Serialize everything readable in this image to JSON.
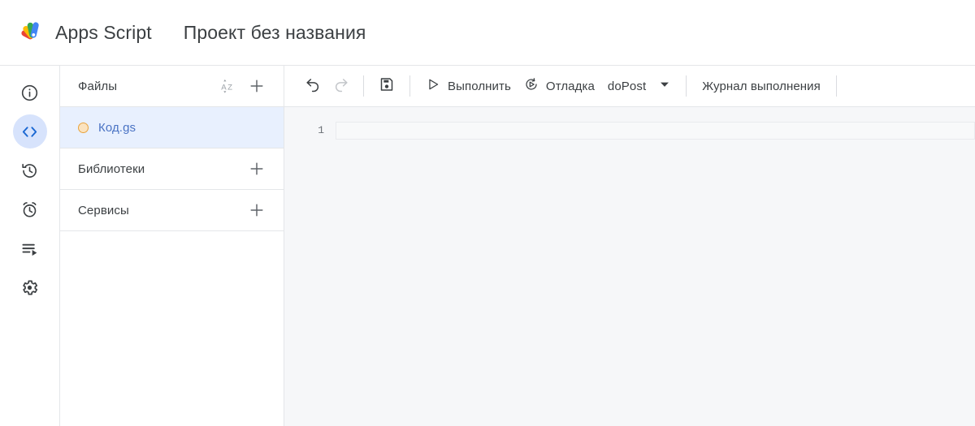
{
  "header": {
    "logo_icon": "apps-script-logo",
    "brand": "Apps Script",
    "project_title": "Проект без названия",
    "logo_colors": {
      "red": "#ea4335",
      "yellow": "#fbbc04",
      "green": "#34a853",
      "blue": "#4285f4"
    }
  },
  "rail": {
    "items": [
      {
        "icon": "info-icon",
        "name": "overview",
        "active": false
      },
      {
        "icon": "code-icon",
        "name": "editor",
        "active": true
      },
      {
        "icon": "history-icon",
        "name": "project-history",
        "active": false
      },
      {
        "icon": "alarm-clock-icon",
        "name": "triggers",
        "active": false
      },
      {
        "icon": "executions-icon",
        "name": "executions",
        "active": false
      },
      {
        "icon": "gear-icon",
        "name": "settings",
        "active": false
      }
    ],
    "active_color": "#1967d2",
    "active_bg": "#d7e3fc"
  },
  "files_panel": {
    "header": {
      "label": "Файлы",
      "sort_icon": "sort-az-icon",
      "add_icon": "plus-icon"
    },
    "files": [
      {
        "name": "Код.gs",
        "status_icon": "unsaved-dot-icon",
        "status_color": "#e8a33d",
        "selected": true,
        "selected_bg": "#e8f0fe",
        "text_color": "#4a73c4"
      }
    ],
    "sections": [
      {
        "label": "Библиотеки",
        "add_icon": "plus-icon"
      },
      {
        "label": "Сервисы",
        "add_icon": "plus-icon"
      }
    ]
  },
  "toolbar": {
    "undo": {
      "icon": "undo-icon",
      "label": "Отменить",
      "disabled": false
    },
    "redo": {
      "icon": "redo-icon",
      "label": "Повторить",
      "disabled": true
    },
    "save": {
      "icon": "save-floppy-icon",
      "label": "Сохранить"
    },
    "run": {
      "icon": "play-triangle-icon",
      "label": "Выполнить"
    },
    "debug": {
      "icon": "debug-icon",
      "label": "Отладка"
    },
    "function_select": {
      "value": "doPost",
      "caret_icon": "chevron-down-icon"
    },
    "execution_log": {
      "label": "Журнал выполнения"
    }
  },
  "editor": {
    "line_numbers": [
      "1"
    ],
    "lines": [
      ""
    ],
    "active_line": 1,
    "background": "#f6f7f9",
    "active_line_bg": "#f8f9fa",
    "active_line_border": "#e9ebee"
  }
}
